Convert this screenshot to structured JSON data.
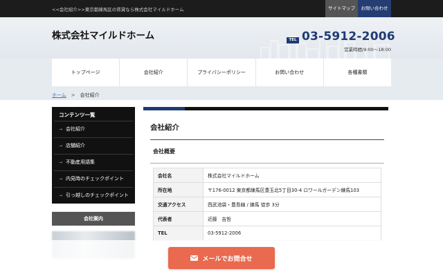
{
  "topbar": {
    "tagline": "<<会社紹介>>東京都練馬区の賃貸なら株式会社マイルドホーム",
    "sitemap_label": "サイトマップ",
    "contact_label": "お問い合わせ"
  },
  "header": {
    "company_name": "株式会社マイルドホーム",
    "tel_badge": "TEL",
    "tel_number": "03-5912-2006",
    "hours": "営業時間/9:00～18:00"
  },
  "nav": {
    "items": [
      "トップページ",
      "会社紹介",
      "プライバシーポリシー",
      "お問い合わせ",
      "各種書類"
    ]
  },
  "breadcrumb": {
    "home": "ホーム",
    "separator": ">",
    "current": "会社紹介"
  },
  "sidebar": {
    "title": "コンテンツ一覧",
    "items": [
      "会社紹介",
      "店舗紹介",
      "不動産用語集",
      "内見時のチェックポイント",
      "引っ越しのチェックポイント"
    ],
    "guide_title": "会社案内"
  },
  "main": {
    "heading": "会社紹介",
    "section_title": "会社概要",
    "table": [
      {
        "label": "会社名",
        "value": "株式会社マイルドホーム"
      },
      {
        "label": "所在地",
        "value": "〒176-0012 東京都練馬区豊玉北5丁目30-4 ロワールガーデン練馬103"
      },
      {
        "label": "交通アクセス",
        "value": "西武池袋・豊島線 / 練馬 徒歩 3分"
      },
      {
        "label": "代表者",
        "value": "近藤　吉哲"
      },
      {
        "label": "TEL",
        "value": "03-5912-2006"
      }
    ]
  },
  "floating": {
    "mail_button_label": "メールでお問合せ",
    "icon": "envelope-icon"
  },
  "colors": {
    "brand_navy": "#1f3b73",
    "mail_button": "#ea6a4f",
    "topbar": "#1c1c1c"
  }
}
